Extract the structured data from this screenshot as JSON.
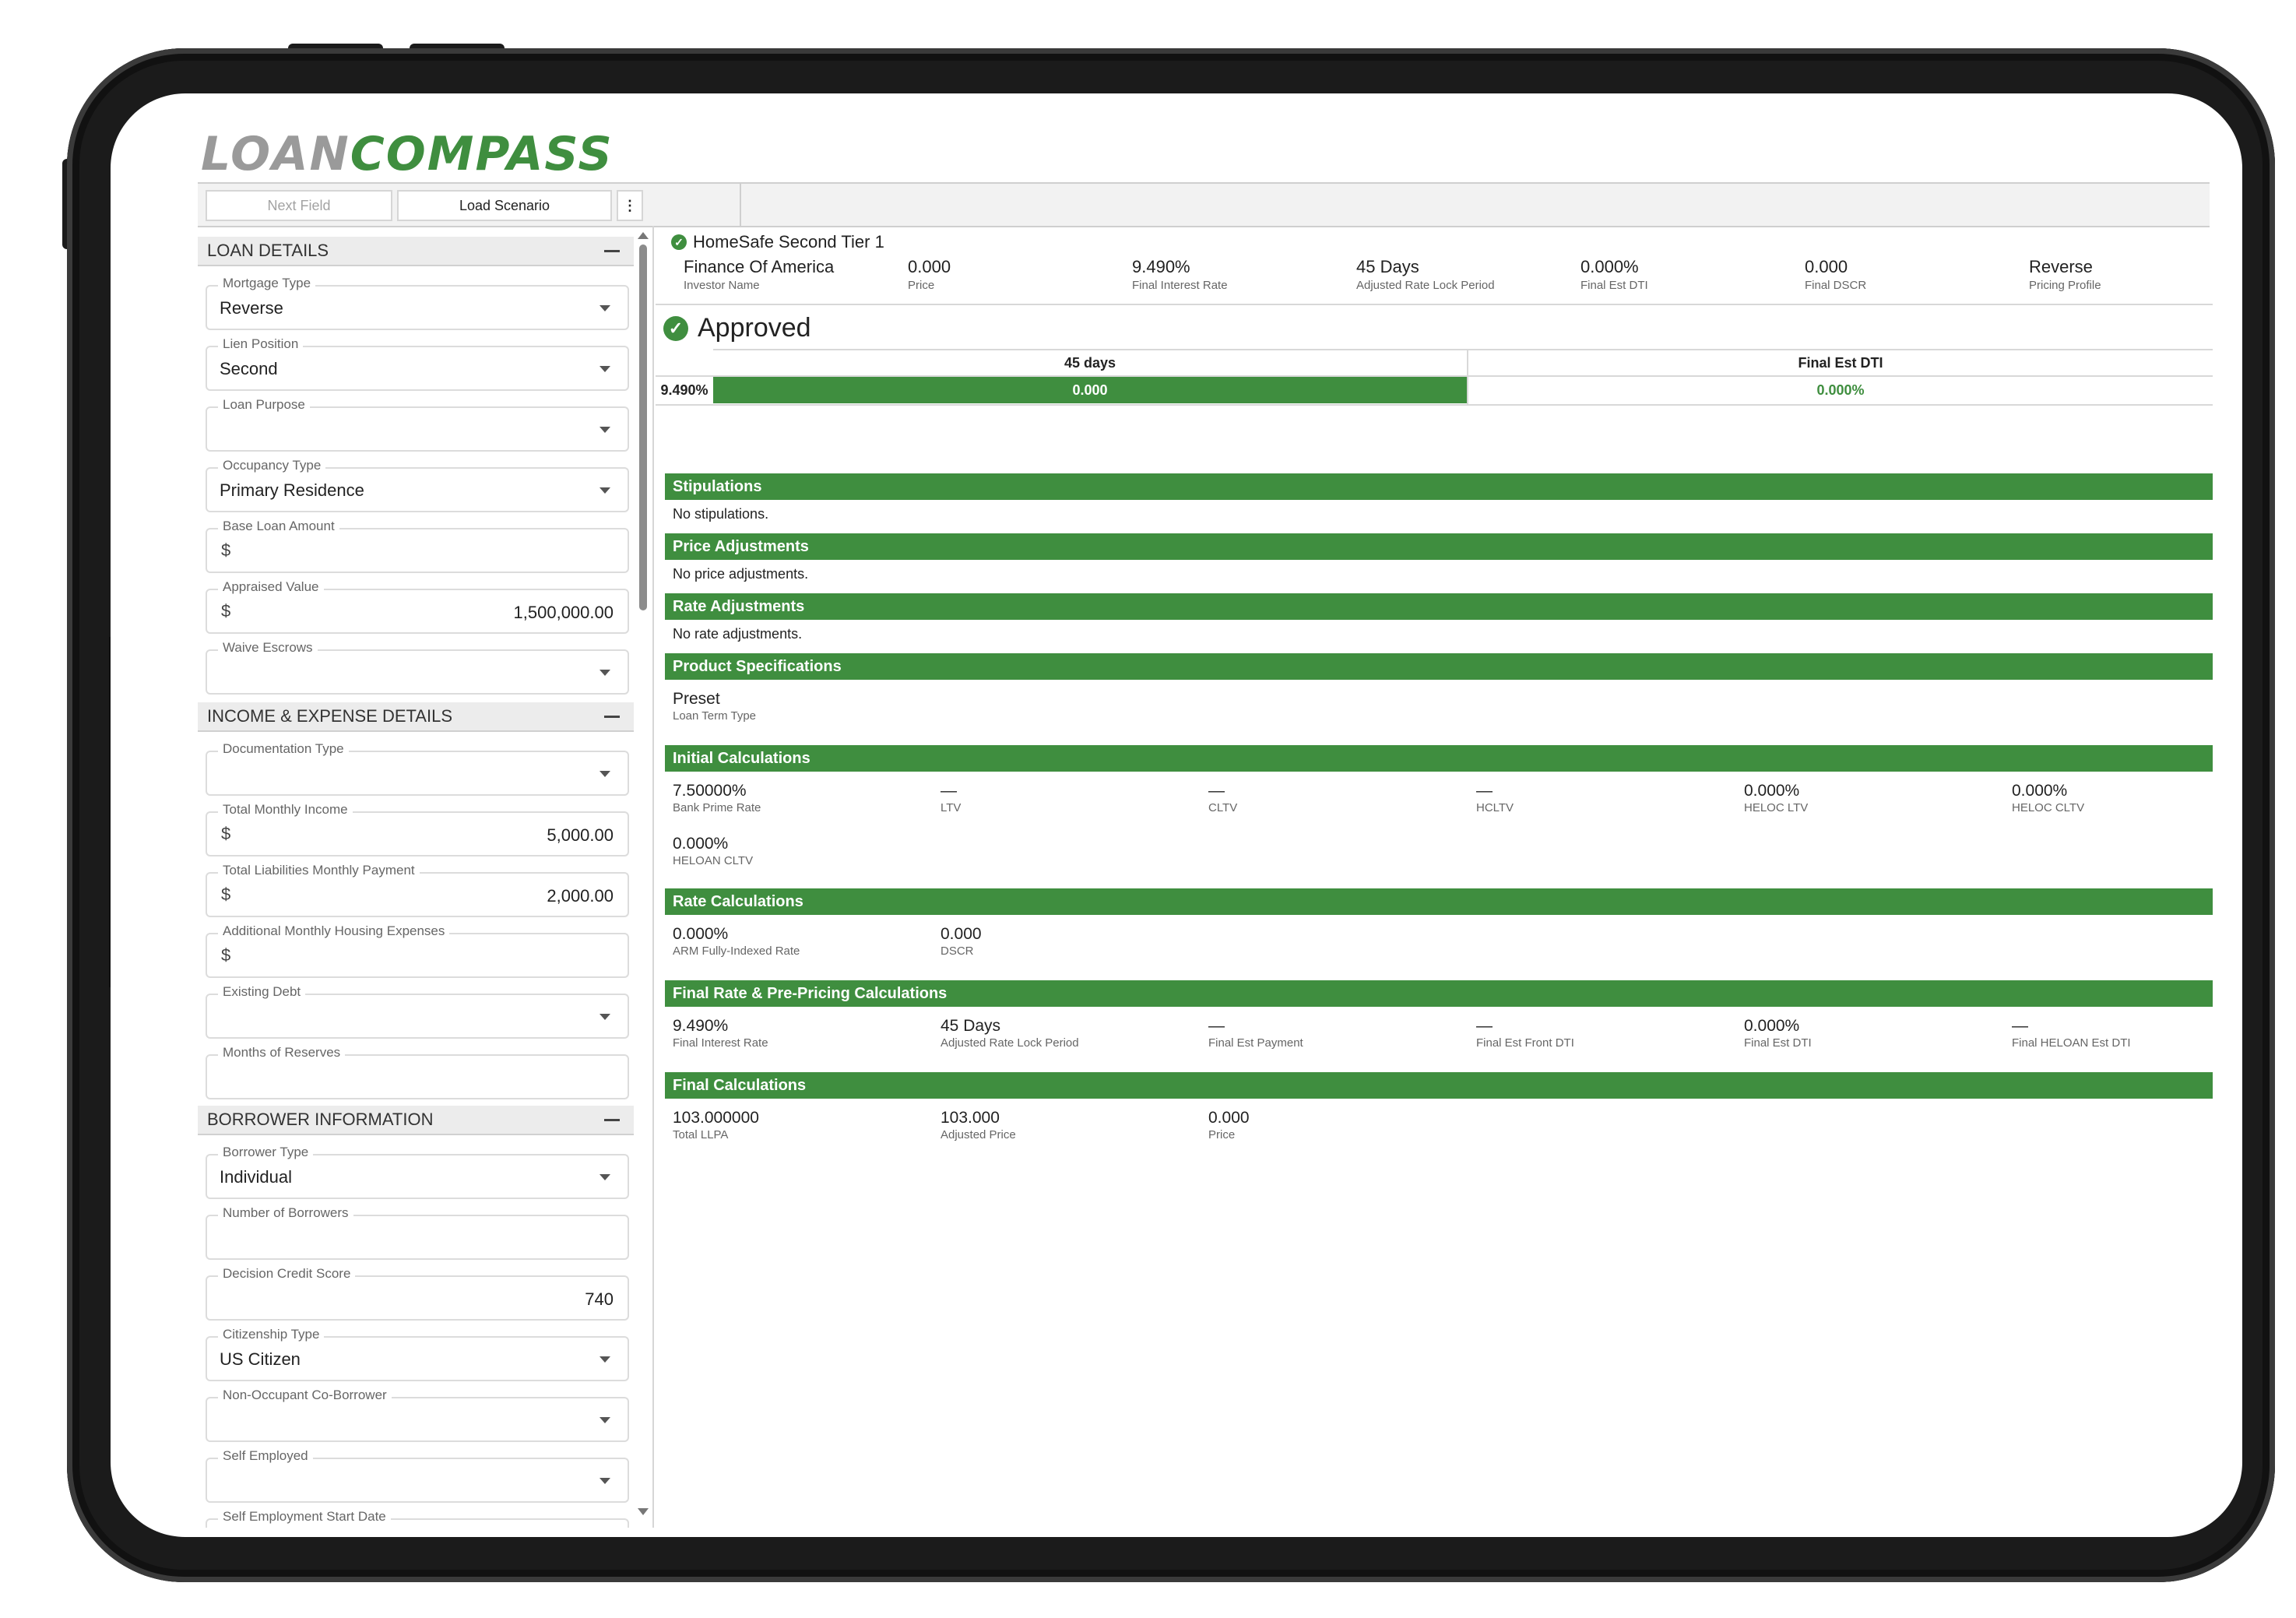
{
  "logo": {
    "part1": "LOAN",
    "part2": "COMPASS"
  },
  "toolbar": {
    "next_field": "Next Field",
    "load_scenario": "Load Scenario",
    "more": "⋮"
  },
  "loan_details": {
    "title": "LOAN DETAILS",
    "fields": [
      {
        "label": "Mortgage Type",
        "value": "Reverse"
      },
      {
        "label": "Lien Position",
        "value": "Second"
      },
      {
        "label": "Loan Purpose",
        "value": ""
      },
      {
        "label": "Occupancy Type",
        "value": "Primary Residence"
      },
      {
        "label": "Base Loan Amount",
        "prefix": "$",
        "value": ""
      },
      {
        "label": "Appraised Value",
        "prefix": "$",
        "value": "1,500,000.00"
      },
      {
        "label": "Waive Escrows",
        "value": ""
      }
    ]
  },
  "income": {
    "title": "INCOME & EXPENSE DETAILS",
    "fields": [
      {
        "label": "Documentation Type",
        "value": ""
      },
      {
        "label": "Total Monthly Income",
        "prefix": "$",
        "value": "5,000.00"
      },
      {
        "label": "Total Liabilities Monthly Payment",
        "prefix": "$",
        "value": "2,000.00"
      },
      {
        "label": "Additional Monthly Housing Expenses",
        "prefix": "$",
        "value": ""
      },
      {
        "label": "Existing Debt",
        "value": ""
      },
      {
        "label": "Months of Reserves",
        "value": ""
      }
    ]
  },
  "borrower": {
    "title": "BORROWER INFORMATION",
    "fields": [
      {
        "label": "Borrower Type",
        "value": "Individual"
      },
      {
        "label": "Number of Borrowers",
        "value": ""
      },
      {
        "label": "Decision Credit Score",
        "value": "740"
      },
      {
        "label": "Citizenship Type",
        "value": "US Citizen"
      },
      {
        "label": "Non-Occupant Co-Borrower",
        "value": ""
      },
      {
        "label": "Self Employed",
        "value": ""
      },
      {
        "label": "Self Employment Start Date",
        "value": ""
      }
    ]
  },
  "product": {
    "title": "HomeSafe Second Tier 1",
    "summary": [
      {
        "value": "Finance Of America",
        "label": "Investor Name"
      },
      {
        "value": "0.000",
        "label": "Price"
      },
      {
        "value": "9.490%",
        "label": "Final Interest Rate"
      },
      {
        "value": "45 Days",
        "label": "Adjusted Rate Lock Period"
      },
      {
        "value": "0.000%",
        "label": "Final Est DTI"
      },
      {
        "value": "0.000",
        "label": "Final DSCR"
      },
      {
        "value": "Reverse",
        "label": "Pricing Profile"
      }
    ],
    "status": "Approved"
  },
  "grid": {
    "col1_header": "45 days",
    "col2_header": "Final Est DTI",
    "row_rate": "9.490%",
    "cell1": "0.000",
    "cell2": "0.000%",
    "colors": {
      "green": "#3f8e3f"
    }
  },
  "sections": {
    "stipulations": {
      "title": "Stipulations",
      "note": "No stipulations."
    },
    "price_adj": {
      "title": "Price Adjustments",
      "note": "No price adjustments."
    },
    "rate_adj": {
      "title": "Rate Adjustments",
      "note": "No rate adjustments."
    },
    "product_specs": {
      "title": "Product Specifications",
      "items": [
        {
          "value": "Preset",
          "label": "Loan Term Type"
        }
      ]
    },
    "initial_calc": {
      "title": "Initial Calculations",
      "items": [
        {
          "value": "7.50000%",
          "label": "Bank Prime Rate"
        },
        {
          "value": "—",
          "label": "LTV"
        },
        {
          "value": "—",
          "label": "CLTV"
        },
        {
          "value": "—",
          "label": "HCLTV"
        },
        {
          "value": "0.000%",
          "label": "HELOC LTV"
        },
        {
          "value": "0.000%",
          "label": "HELOC CLTV"
        },
        {
          "value": "0.000%",
          "label": "HELOAN CLTV"
        }
      ]
    },
    "rate_calc": {
      "title": "Rate Calculations",
      "items": [
        {
          "value": "0.000%",
          "label": "ARM Fully-Indexed Rate"
        },
        {
          "value": "0.000",
          "label": "DSCR"
        }
      ]
    },
    "final_rate": {
      "title": "Final Rate & Pre-Pricing Calculations",
      "items": [
        {
          "value": "9.490%",
          "label": "Final Interest Rate"
        },
        {
          "value": "45 Days",
          "label": "Adjusted Rate Lock Period"
        },
        {
          "value": "—",
          "label": "Final Est Payment"
        },
        {
          "value": "—",
          "label": "Final Est Front DTI"
        },
        {
          "value": "0.000%",
          "label": "Final Est DTI"
        },
        {
          "value": "—",
          "label": "Final HELOAN Est DTI"
        }
      ]
    },
    "final_calc": {
      "title": "Final Calculations",
      "items": [
        {
          "value": "103.000000",
          "label": "Total LLPA"
        },
        {
          "value": "103.000",
          "label": "Adjusted Price"
        },
        {
          "value": "0.000",
          "label": "Price"
        }
      ]
    }
  }
}
